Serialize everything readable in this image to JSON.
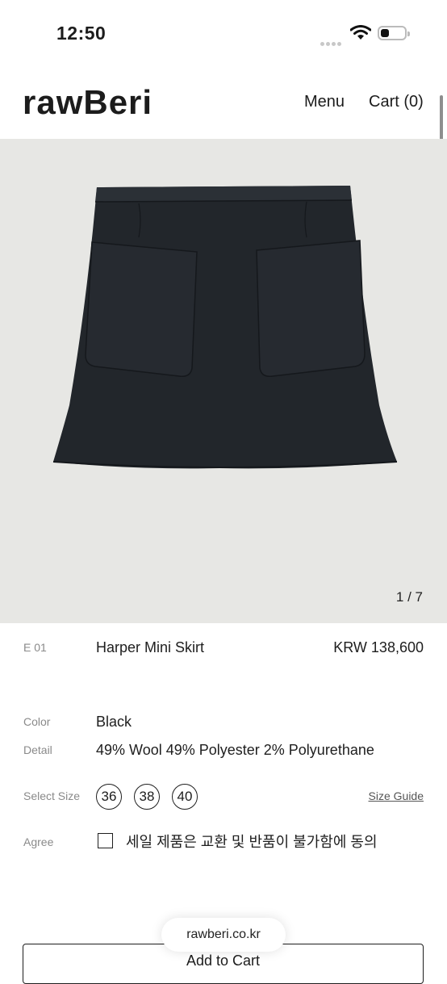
{
  "status_bar": {
    "time": "12:50"
  },
  "header": {
    "logo": "rawBeri",
    "menu_label": "Menu",
    "cart_label": "Cart (0)"
  },
  "gallery": {
    "counter": "1 / 7"
  },
  "product": {
    "code": "E 01",
    "name": "Harper Mini Skirt",
    "price": "KRW 138,600"
  },
  "details": {
    "color_label": "Color",
    "color_value": "Black",
    "detail_label": "Detail",
    "detail_value": "49% Wool 49% Polyester 2% Polyurethane"
  },
  "size": {
    "label": "Select Size",
    "options": [
      "36",
      "38",
      "40"
    ],
    "guide_label": "Size Guide"
  },
  "agree": {
    "label": "Agree",
    "text": "세일 제품은 교환 및 반품이 불가함에 동의"
  },
  "cart_button": {
    "label": "Add to Cart"
  },
  "browser": {
    "url": "rawberi.co.kr"
  }
}
